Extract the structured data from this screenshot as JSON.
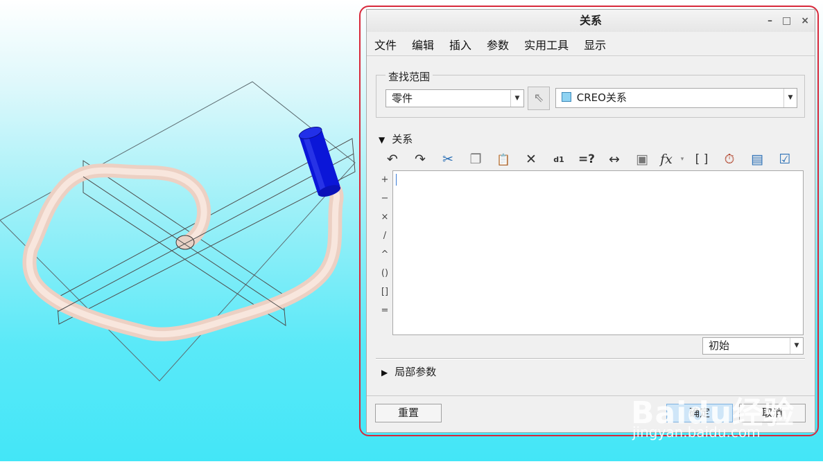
{
  "dialog": {
    "title": "关系",
    "window_buttons": [
      "–",
      "□",
      "×"
    ],
    "menu": [
      "文件",
      "编辑",
      "插入",
      "参数",
      "实用工具",
      "显示"
    ],
    "lookup": {
      "legend": "查找范围",
      "scope_value": "零件",
      "model_value": "CREO关系"
    },
    "relations_section": {
      "label": "关系",
      "toolbar": [
        {
          "icon": "undo-icon",
          "glyph": "↶"
        },
        {
          "icon": "redo-icon",
          "glyph": "↷"
        },
        {
          "icon": "cut-icon",
          "glyph": "✂"
        },
        {
          "icon": "copy-icon",
          "glyph": "❐"
        },
        {
          "icon": "paste-icon",
          "glyph": "📋"
        },
        {
          "icon": "delete-icon",
          "glyph": "✕"
        },
        {
          "icon": "show-values-icon",
          "glyph": "d1"
        },
        {
          "icon": "evaluate-icon",
          "glyph": "=?"
        },
        {
          "icon": "insert-dimension-icon",
          "glyph": "↔"
        },
        {
          "icon": "insert-parameter-icon",
          "glyph": "▣"
        },
        {
          "icon": "insert-function-icon",
          "glyph": "fx"
        },
        {
          "icon": "function-dropdown-icon",
          "glyph": "▾"
        },
        {
          "icon": "brackets-icon",
          "glyph": "[ ]"
        },
        {
          "icon": "timer-icon",
          "glyph": "⏱"
        },
        {
          "icon": "sort-icon",
          "glyph": "▤"
        },
        {
          "icon": "verify-icon",
          "glyph": "☑"
        }
      ],
      "operators": [
        "+",
        "−",
        "×",
        "/",
        "^",
        "()",
        "[]",
        "="
      ],
      "editor_text": "",
      "units_value": "初始"
    },
    "local_params_label": "局部参数",
    "buttons": {
      "reset": "重置",
      "ok": "确定",
      "cancel": "取消"
    }
  },
  "watermark": {
    "brand": "Baidu经验",
    "url": "jingyan.baidu.com"
  },
  "colors": {
    "highlight_outline": "#d8283a",
    "pipe": "#f3d9cc",
    "cylinder": "#0a14d6"
  }
}
